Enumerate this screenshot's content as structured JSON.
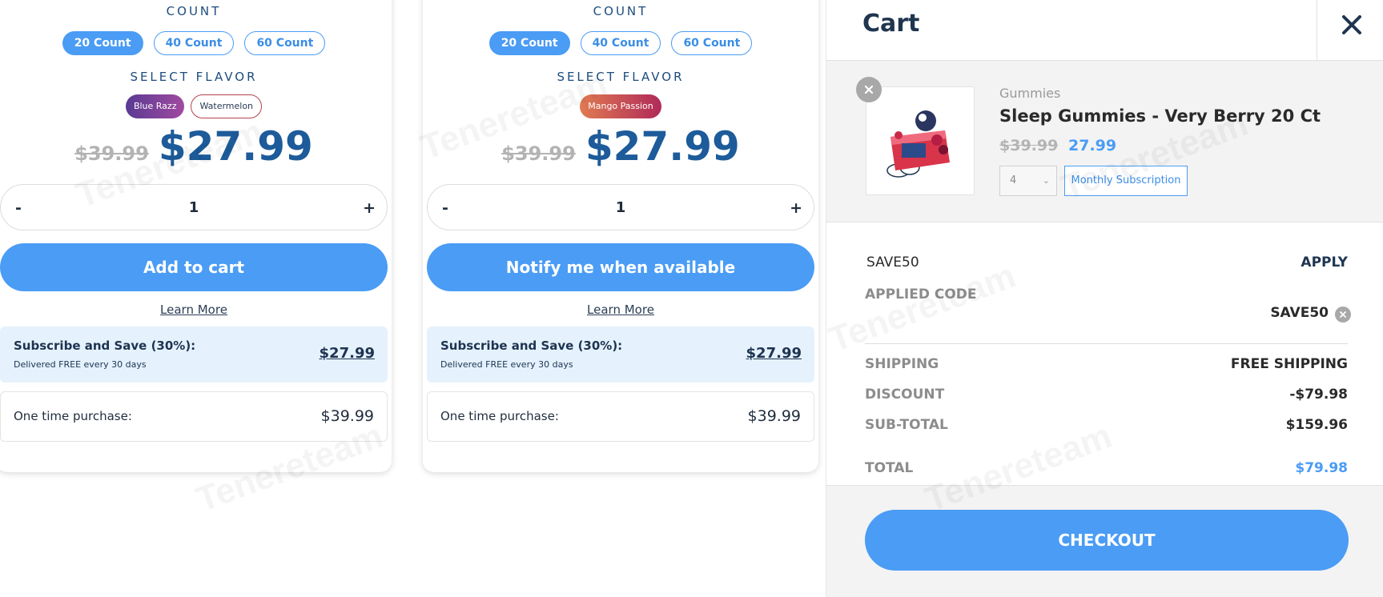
{
  "products": [
    {
      "count_heading": "COUNT",
      "counts": [
        "20 Count",
        "40 Count",
        "60 Count"
      ],
      "flavor_heading": "SELECT FLAVOR",
      "flavors": [
        "Blue Razz",
        "Watermelon"
      ],
      "old_price": "$39.99",
      "price": "$27.99",
      "quantity_minus": "-",
      "quantity": "1",
      "quantity_plus": "+",
      "action_label": "Add to cart",
      "learn_more": "Learn More",
      "subscribe_title": "Subscribe and Save (30%):",
      "subscribe_note": "Delivered FREE every 30 days",
      "subscribe_price": "$27.99",
      "one_time_label": "One time purchase:",
      "one_time_price": "$39.99"
    },
    {
      "count_heading": "COUNT",
      "counts": [
        "20 Count",
        "40 Count",
        "60 Count"
      ],
      "flavor_heading": "SELECT FLAVOR",
      "flavors": [
        "Mango Passion"
      ],
      "old_price": "$39.99",
      "price": "$27.99",
      "quantity_minus": "-",
      "quantity": "1",
      "quantity_plus": "+",
      "action_label": "Notify me when available",
      "learn_more": "Learn More",
      "subscribe_title": "Subscribe and Save (30%):",
      "subscribe_note": "Delivered FREE every 30 days",
      "subscribe_price": "$27.99",
      "one_time_label": "One time purchase:",
      "one_time_price": "$39.99"
    }
  ],
  "cart": {
    "title": "Cart",
    "item": {
      "category": "Gummies",
      "name": "Sleep Gummies - Very Berry 20 Ct",
      "old_price": "$39.99",
      "price": "27.99",
      "quantity": "4",
      "subscription_label": "Monthly Subscription"
    },
    "promo": {
      "code": "SAVE50",
      "apply_label": "APPLY",
      "applied_label": "APPLIED CODE",
      "applied_code": "SAVE50"
    },
    "totals": {
      "shipping_label": "SHIPPING",
      "shipping_value": "FREE SHIPPING",
      "discount_label": "DISCOUNT",
      "discount_value": "-$79.98",
      "subtotal_label": "SUB-TOTAL",
      "subtotal_value": "$159.96",
      "total_label": "TOTAL",
      "total_value": "$79.98"
    },
    "checkout_label": "CHECKOUT"
  },
  "colors": {
    "accent": "#4a9cf5",
    "price_blue": "#1d5b9a",
    "subscribe_bg": "#e5f2fd",
    "panel_gray": "#f3f3f3"
  },
  "watermark": "Tenereteam"
}
